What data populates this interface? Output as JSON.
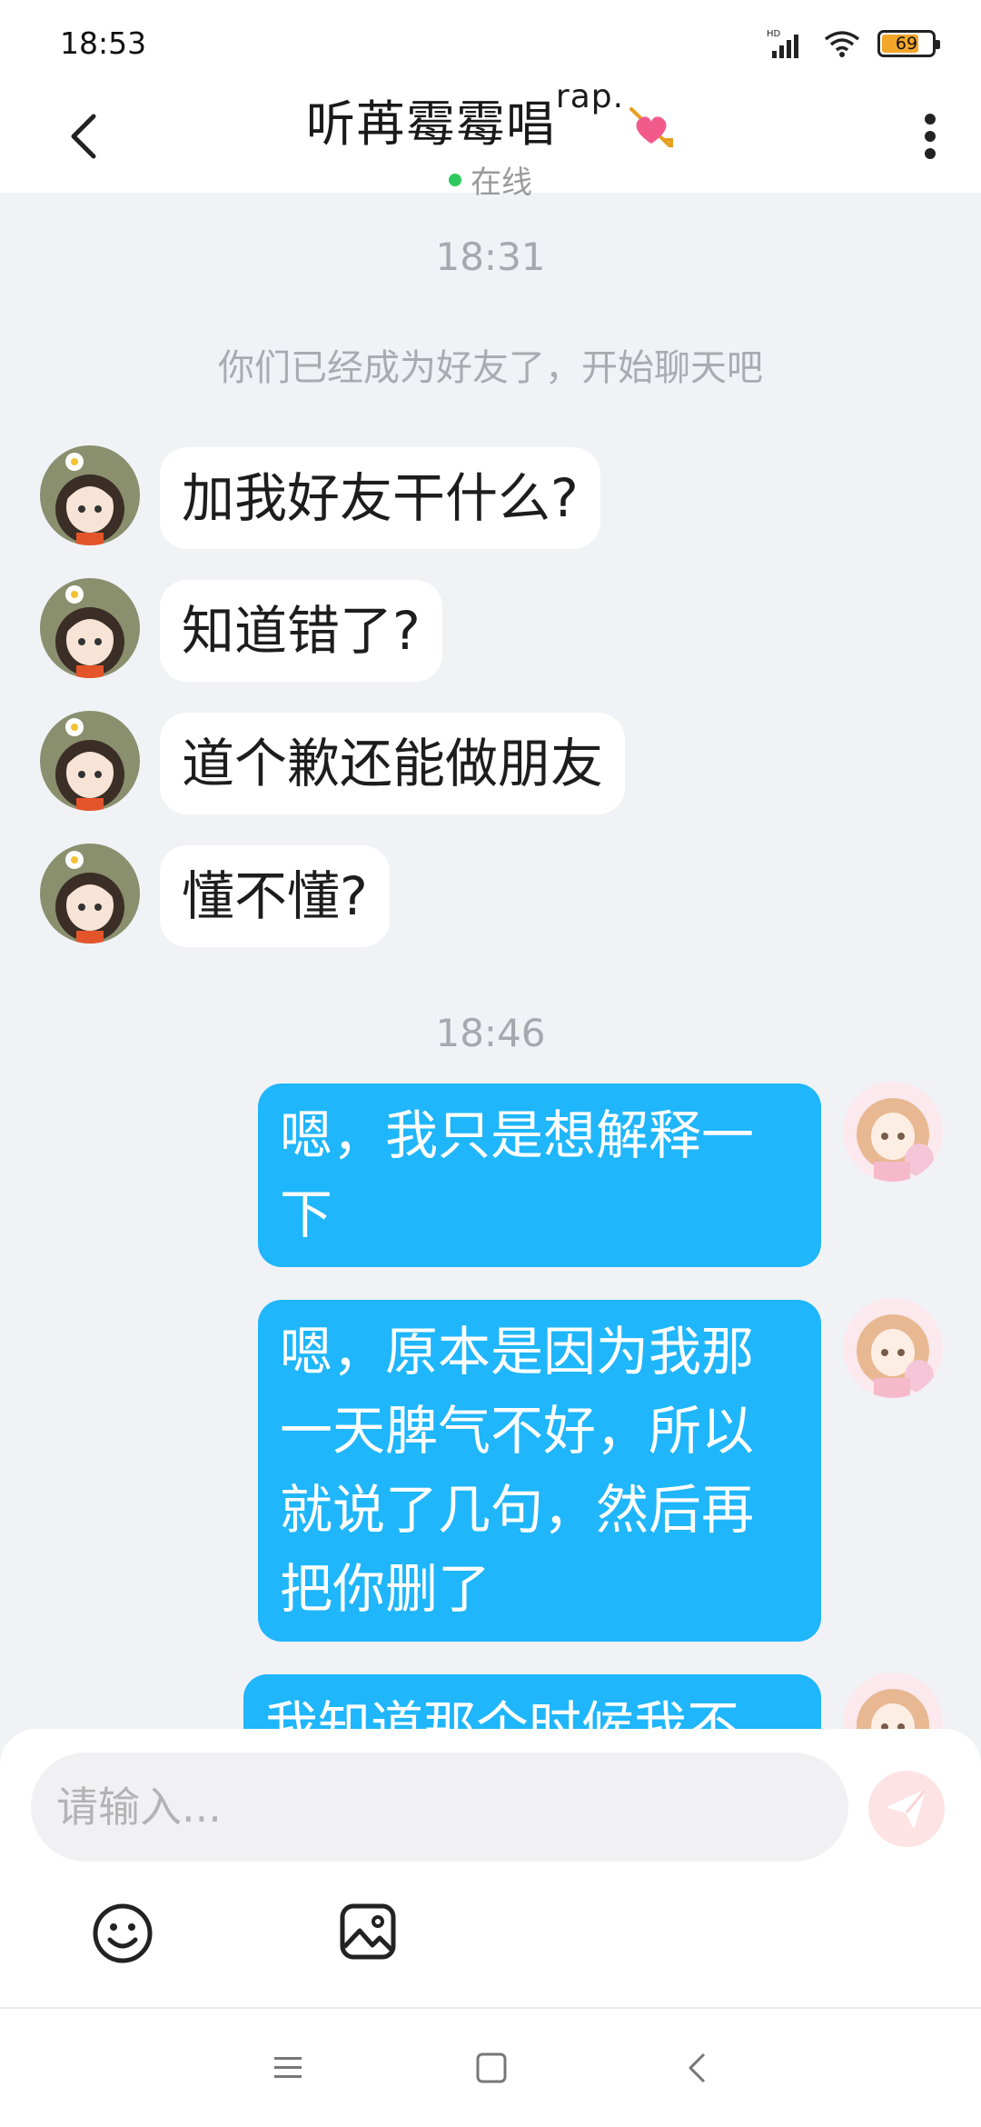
{
  "status_bar": {
    "time": "18:53",
    "battery": "69",
    "battery_level": 0.69
  },
  "header": {
    "title": "听苒霉霉唱",
    "title_suffix": "rap.",
    "presence": "在线"
  },
  "chat": {
    "timestamp_1": "18:31",
    "system_message": "你们已经成为好友了，开始聊天吧",
    "incoming": [
      "加我好友干什么?",
      "知道错了?",
      "道个歉还能做朋友",
      "懂不懂?"
    ],
    "timestamp_2": "18:46",
    "outgoing": [
      "嗯，我只是想解释一下",
      "嗯，原本是因为我那一天脾气不好，所以就说了几句，然后再把你删了",
      "我知道那个时候我不"
    ]
  },
  "input": {
    "placeholder": "请输入..."
  },
  "icons": {
    "back": "chevron-left-icon",
    "more": "more-vertical-icon",
    "heart": "heart-arrow-icon",
    "send": "send-icon",
    "emoji": "emoji-icon",
    "image": "image-icon",
    "nav_menu": "menu-icon",
    "nav_home": "home-square-icon",
    "nav_back": "back-triangle-icon"
  },
  "colors": {
    "accent": "#1fb6fb",
    "online": "#2ec95c",
    "send_bg": "#fde3e3"
  }
}
